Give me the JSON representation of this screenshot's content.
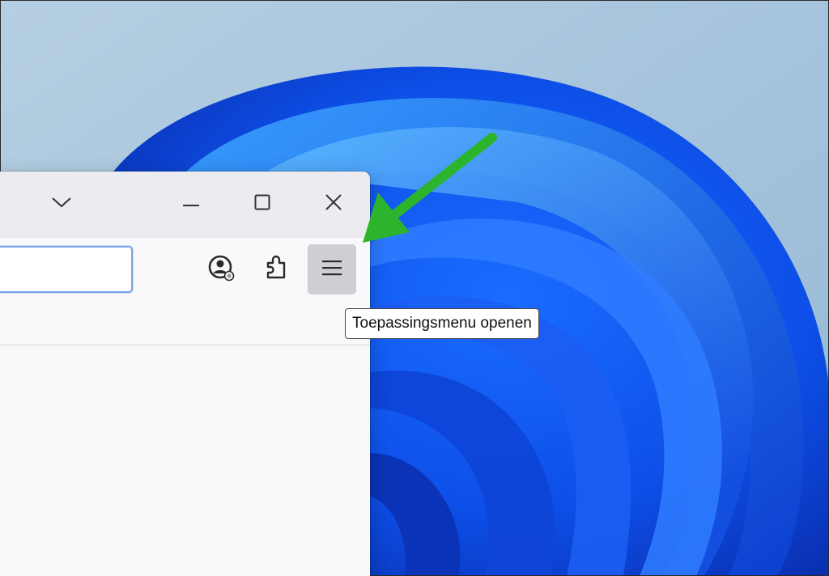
{
  "desktop": {
    "wallpaper": "windows-11-bloom"
  },
  "window": {
    "controls": {
      "tab_list_icon": "chevron-down-icon",
      "minimize_icon": "minimize-icon",
      "maximize_icon": "maximize-icon",
      "close_icon": "close-icon"
    }
  },
  "toolbar": {
    "url_value": "",
    "buttons": [
      {
        "name": "account",
        "icon": "account-icon"
      },
      {
        "name": "extensions",
        "icon": "puzzle-piece-icon"
      },
      {
        "name": "app-menu",
        "icon": "hamburger-menu-icon",
        "active": true
      }
    ]
  },
  "tooltip": {
    "text": "Toepassingsmenu openen"
  },
  "annotation": {
    "arrow_color": "#2db42d"
  },
  "colors": {
    "window_bg": "#f9f9fb",
    "titlebar_bg": "#ececf0",
    "accent_focus": "#7aa4e8",
    "button_hover": "#cfcfd3"
  }
}
